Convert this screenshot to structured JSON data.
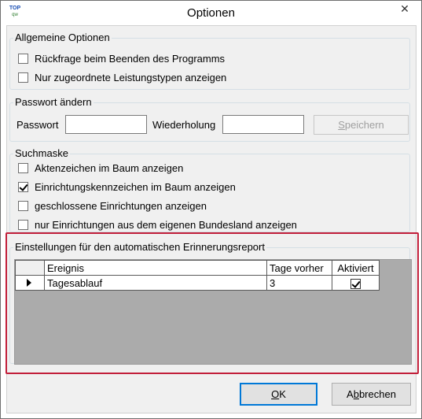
{
  "window": {
    "title": "Optionen",
    "logo_text": "TOP",
    "logo_sub": "qw",
    "close_glyph": "✕"
  },
  "general": {
    "legend": "Allgemeine Optionen",
    "options": [
      {
        "label": "Rückfrage beim Beenden des Programms",
        "checked": false
      },
      {
        "label": "Nur zugeordnete Leistungstypen anzeigen",
        "checked": false
      }
    ]
  },
  "password": {
    "legend": "Passwort ändern",
    "password_label": "Passwort",
    "password_value": "",
    "repeat_label": "Wiederholung",
    "repeat_value": "",
    "save_label_prefix": "",
    "save_label_access": "S",
    "save_label_rest": "peichern"
  },
  "search": {
    "legend": "Suchmaske",
    "options": [
      {
        "label": "Aktenzeichen im Baum anzeigen",
        "checked": false
      },
      {
        "label": "Einrichtungskennzeichen im Baum anzeigen",
        "checked": true
      },
      {
        "label": "geschlossene Einrichtungen anzeigen",
        "checked": false
      },
      {
        "label": "nur Einrichtungen aus dem eigenen Bundesland anzeigen",
        "checked": false
      }
    ]
  },
  "reminder": {
    "legend": "Einstellungen für den automatischen Erinnerungsreport",
    "columns": {
      "event": "Ereignis",
      "days": "Tage vorher",
      "active": "Aktiviert"
    },
    "rows": [
      {
        "event": "Tagesablauf",
        "days": "3",
        "active": true
      }
    ]
  },
  "footer": {
    "ok_access": "O",
    "ok_rest": "K",
    "cancel_prefix": "A",
    "cancel_access": "b",
    "cancel_rest": "brechen"
  },
  "colors": {
    "highlight": "#c21f3a",
    "dialog_bg": "#f0f0f0"
  }
}
